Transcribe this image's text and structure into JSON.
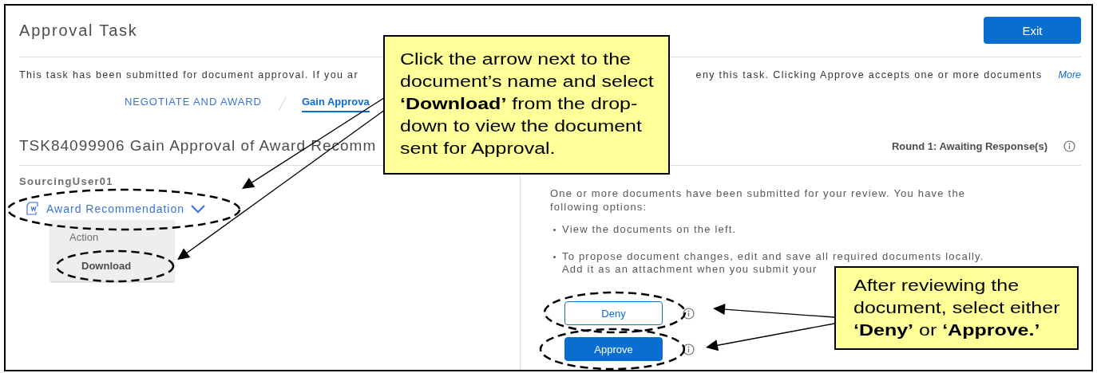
{
  "header": {
    "title": "Approval Task",
    "exit_button": "Exit"
  },
  "description": {
    "left_text": "This task has been submitted for document approval. If you ar",
    "right_text": "eny this task. Clicking Approve accepts one or more documents",
    "more_link": "More"
  },
  "breadcrumb": [
    {
      "label": "NEGOTIATE AND AWARD",
      "selected": false
    },
    {
      "label": "Gain Approva",
      "selected": true
    }
  ],
  "task": {
    "title": "TSK84099906 Gain Approval of Award Recomm",
    "status": "Round 1: Awaiting Response(s)"
  },
  "left_panel": {
    "user": "SourcingUser01",
    "document": "Award Recommendation",
    "menu": {
      "header": "Action",
      "items": [
        "Download"
      ]
    }
  },
  "right_panel": {
    "intro": "One or more documents have been submitted for your review. You have the following options:",
    "bullets": [
      {
        "lines": [
          "View the documents on the left."
        ]
      },
      {
        "lines": [
          "To propose document changes, edit and save all required documents locally.",
          "Add it as an attachment when you submit your"
        ]
      }
    ],
    "actions": [
      {
        "label": "Deny",
        "kind": "secondary"
      },
      {
        "label": "Approve",
        "kind": "primary"
      }
    ]
  },
  "callouts": [
    {
      "text": "Click the arrow next to the document’s name and select **‘Download’** from the drop-down to view the document sent for Approval."
    },
    {
      "text": "After reviewing the document, select either **‘Deny’** or **‘Approve.’**"
    }
  ]
}
